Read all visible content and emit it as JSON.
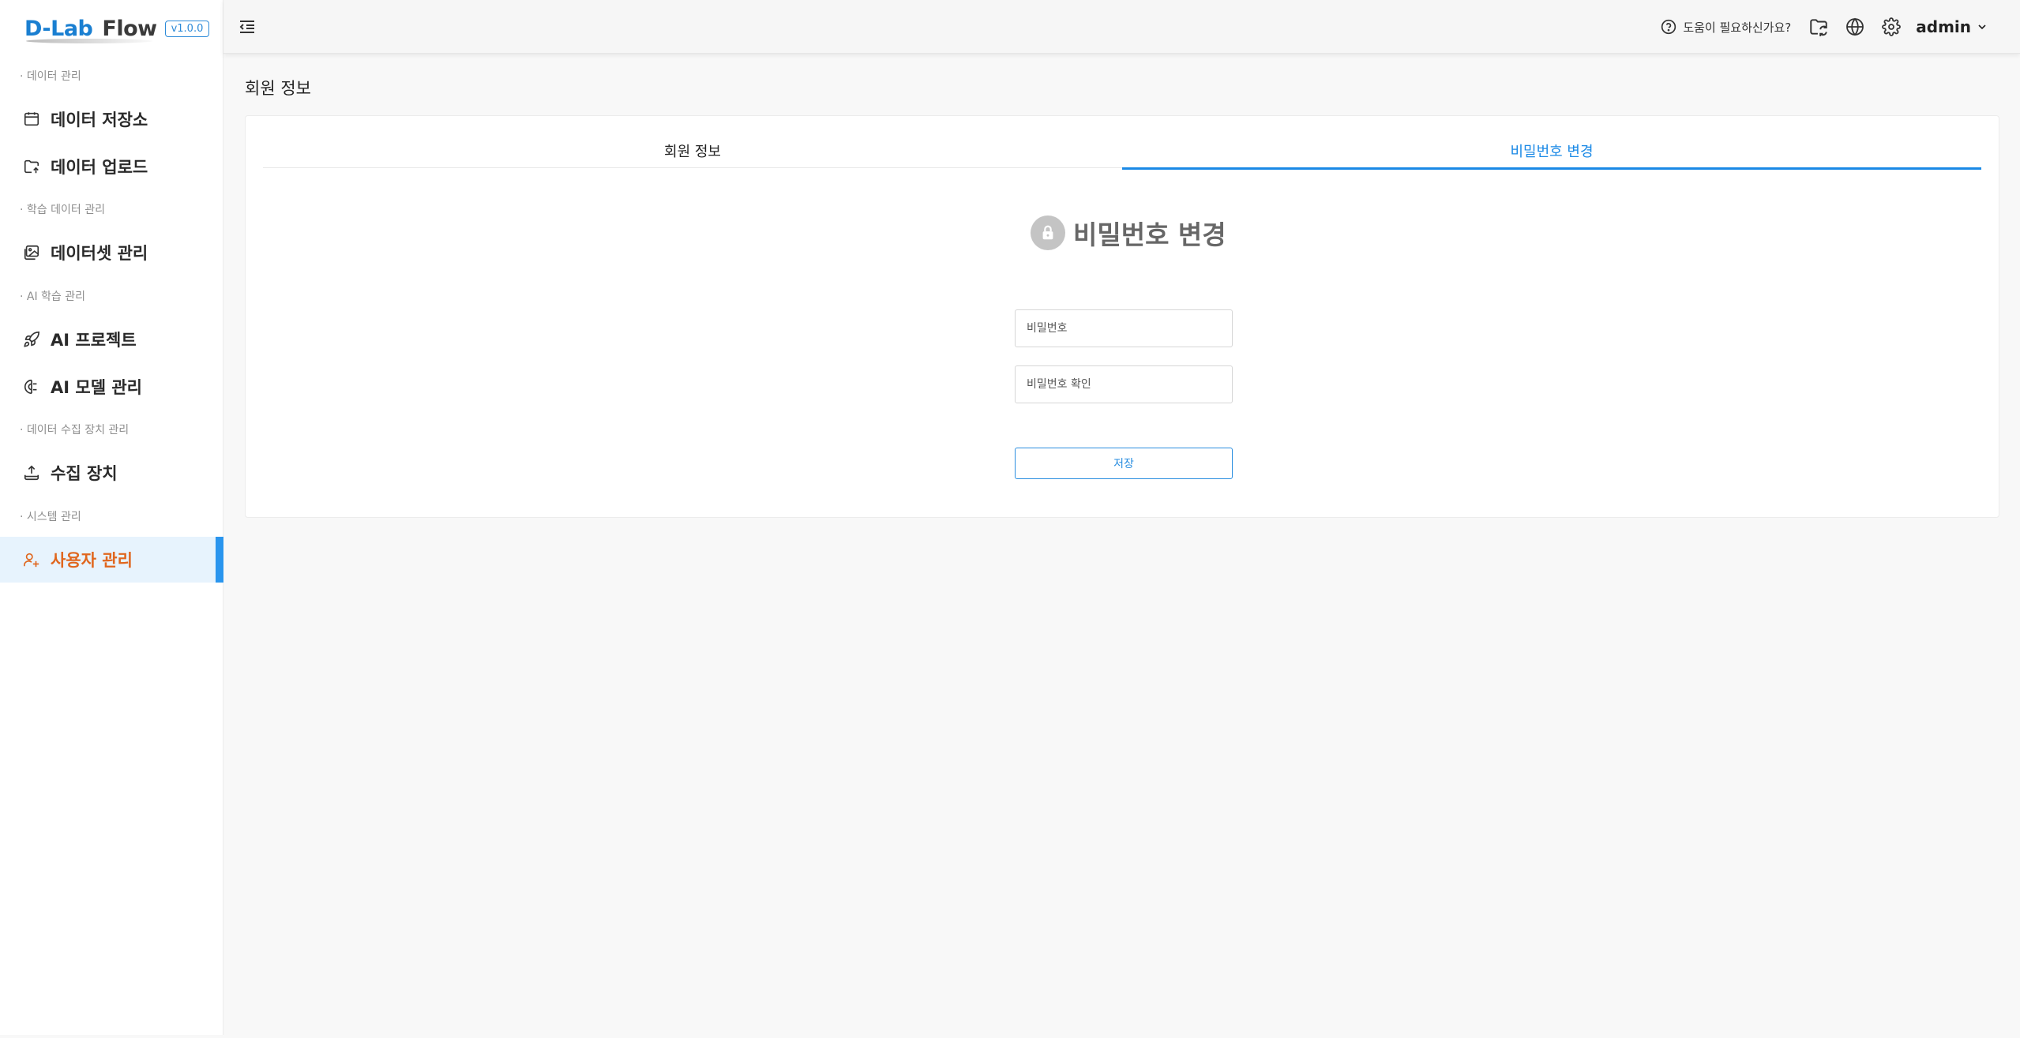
{
  "app": {
    "logo_primary": "D-Lab",
    "logo_secondary": "Flow",
    "version": "v1.0.0"
  },
  "sidebar": {
    "sections": [
      {
        "label": "· 데이터 관리"
      },
      {
        "label": "· 학습 데이터 관리"
      },
      {
        "label": "· AI 학습 관리"
      },
      {
        "label": "· 데이터 수집 장치 관리"
      },
      {
        "label": "· 시스템 관리"
      }
    ],
    "items": [
      {
        "label": "데이터 저장소",
        "icon": "archive-icon"
      },
      {
        "label": "데이터 업로드",
        "icon": "folder-upload-icon"
      },
      {
        "label": "데이터셋 관리",
        "icon": "images-icon"
      },
      {
        "label": "AI 프로젝트",
        "icon": "rocket-icon"
      },
      {
        "label": "AI 모델 관리",
        "icon": "brain-icon"
      },
      {
        "label": "수집 장치",
        "icon": "upload-device-icon"
      },
      {
        "label": "사용자 관리",
        "icon": "users-icon",
        "active": true
      }
    ]
  },
  "header": {
    "help_text": "도움이 필요하신가요?",
    "username": "admin"
  },
  "main": {
    "page_title": "회원 정보",
    "tabs": [
      {
        "label": "회원 정보"
      },
      {
        "label": "비밀번호 변경",
        "active": true
      }
    ],
    "form": {
      "title": "비밀번호 변경",
      "password_placeholder": "비밀번호",
      "confirm_placeholder": "비밀번호 확인",
      "save_label": "저장"
    }
  },
  "colors": {
    "accent": "#1a89e6",
    "active_nav_text": "#e0661e",
    "active_nav_bg": "#e7f3fd"
  }
}
